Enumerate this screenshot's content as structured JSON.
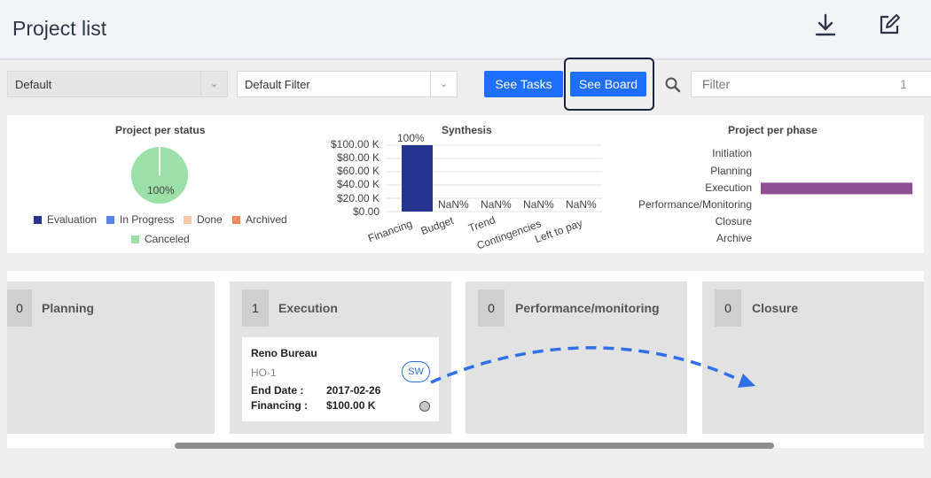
{
  "header": {
    "title": "Project list",
    "icons": [
      "download-icon",
      "edit-icon"
    ]
  },
  "toolbar": {
    "view_select": "Default",
    "filter_select": "Default Filter",
    "see_tasks_label": "See Tasks",
    "see_board_label": "See Board",
    "filter_placeholder": "Filter",
    "filter_count": "1",
    "accent_color": "#1f6fff"
  },
  "status_chart": {
    "title": "Project per status",
    "slice_label": "100%",
    "legend": [
      {
        "label": "Evaluation",
        "color": "#24348f"
      },
      {
        "label": "In Progress",
        "color": "#5b84e8"
      },
      {
        "label": "Done",
        "color": "#f6c9a3"
      },
      {
        "label": "Archived",
        "color": "#f08a5d"
      },
      {
        "label": "Canceled",
        "color": "#9be0a7"
      }
    ]
  },
  "synthesis_chart": {
    "title": "Synthesis",
    "y_ticks": [
      "$100.00 K",
      "$80.00 K",
      "$60.00 K",
      "$40.00 K",
      "$20.00 K",
      "$0.00"
    ],
    "categories": [
      "Financing",
      "Budget",
      "Trend",
      "Contingencies",
      "Left to pay"
    ],
    "bar_labels": [
      "100%",
      "NaN%",
      "NaN%",
      "NaN%",
      "NaN%"
    ]
  },
  "phase_chart": {
    "title": "Project per phase",
    "phases": [
      "Initiation",
      "Planning",
      "Execution",
      "Performance/Monitoring",
      "Closure",
      "Archive"
    ]
  },
  "chart_data": [
    {
      "type": "pie",
      "title": "Project per status",
      "categories": [
        "Evaluation",
        "In Progress",
        "Done",
        "Archived",
        "Canceled"
      ],
      "values": [
        0,
        0,
        0,
        0,
        100
      ],
      "colors": [
        "#24348f",
        "#5b84e8",
        "#f6c9a3",
        "#f08a5d",
        "#9be0a7"
      ],
      "legend": "bottom"
    },
    {
      "type": "bar",
      "title": "Synthesis",
      "categories": [
        "Financing",
        "Budget",
        "Trend",
        "Contingencies",
        "Left to pay"
      ],
      "values": [
        100,
        0,
        0,
        0,
        0
      ],
      "ylim": [
        0,
        100
      ],
      "ylabel_unit": "$ K",
      "grid": true,
      "color": "#24348f"
    },
    {
      "type": "bar",
      "orientation": "horizontal",
      "title": "Project per phase",
      "categories": [
        "Initiation",
        "Planning",
        "Execution",
        "Performance/Monitoring",
        "Closure",
        "Archive"
      ],
      "values": [
        0,
        0,
        1,
        0,
        0,
        0
      ],
      "color": "#8e4e94"
    }
  ],
  "board": {
    "columns": [
      {
        "count": "0",
        "title": "Planning"
      },
      {
        "count": "1",
        "title": "Execution"
      },
      {
        "count": "0",
        "title": "Performance/monitoring"
      },
      {
        "count": "0",
        "title": "Closure"
      }
    ],
    "card": {
      "title": "Reno Bureau",
      "code": "HO-1",
      "end_date_label": "End Date :",
      "end_date_value": "2017-02-26",
      "financing_label": "Financing :",
      "financing_value": "$100.00 K",
      "badge": "SW"
    }
  }
}
